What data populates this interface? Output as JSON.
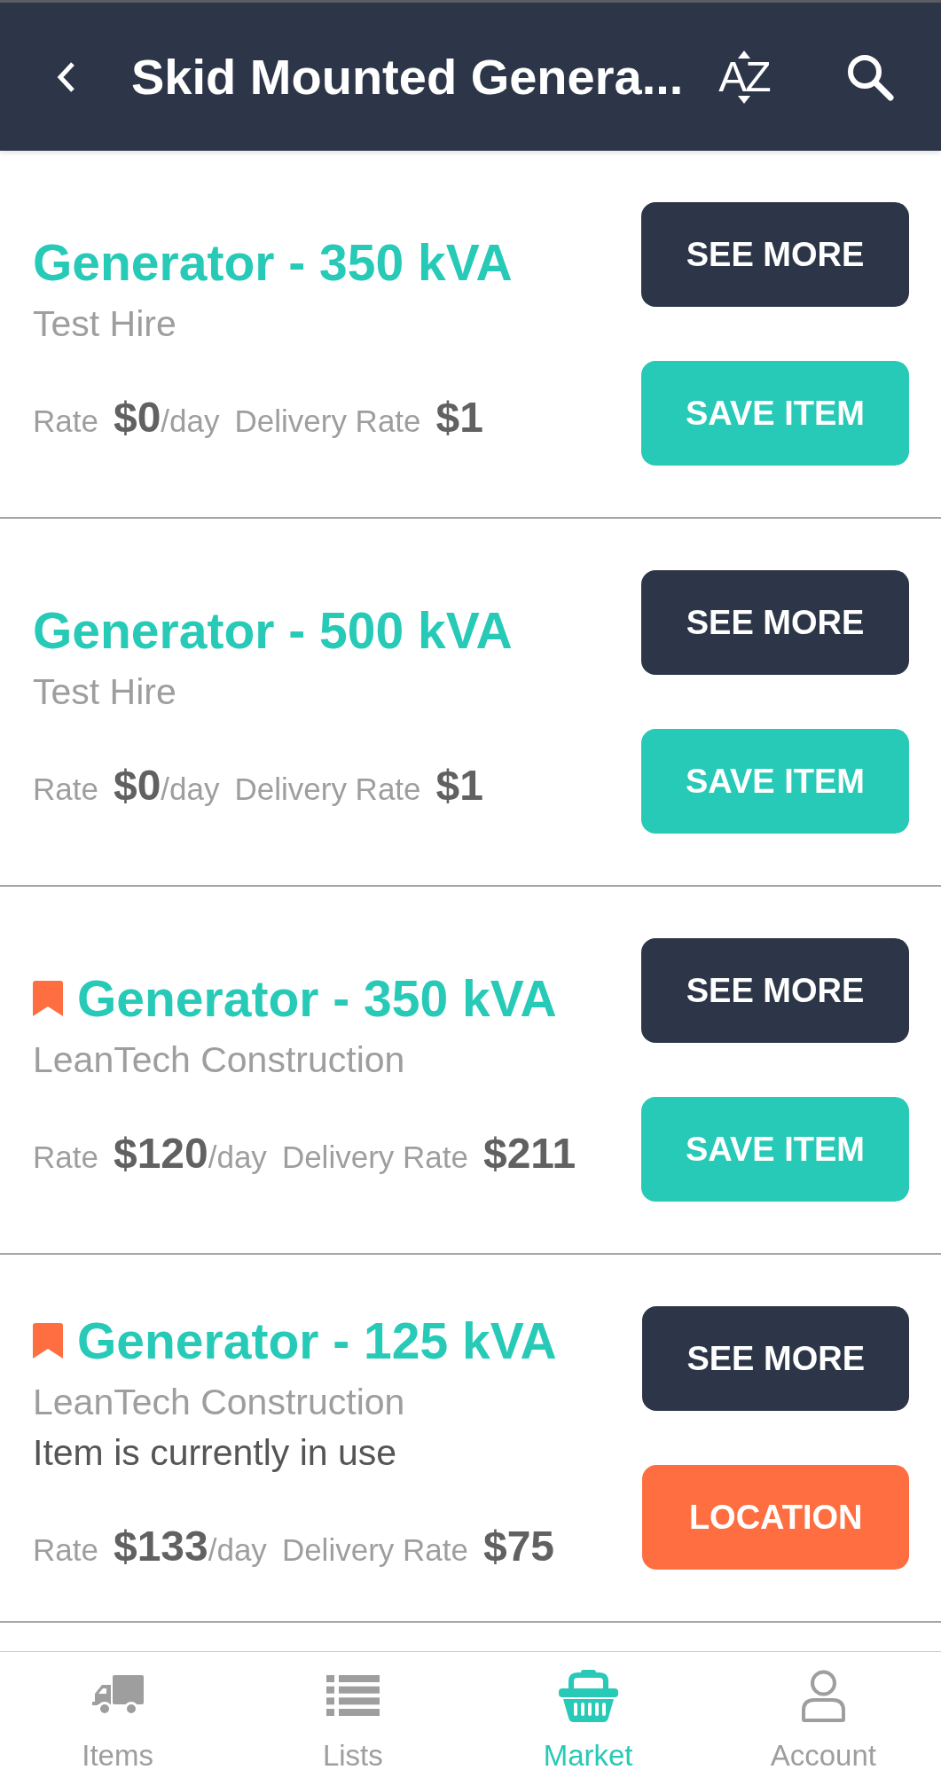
{
  "header": {
    "title": "Skid Mounted Genera...",
    "sort_label": "AZ"
  },
  "cards": [
    {
      "title": "Generator - 350 kVA",
      "bookmarked": false,
      "company": "Test Hire",
      "rate_label": "Rate",
      "rate": "$0",
      "rate_unit": "/day",
      "delivery_label": "Delivery Rate",
      "delivery_rate": "$1",
      "buttons": [
        {
          "label": "SEE MORE",
          "kind": "details"
        },
        {
          "label": "SAVE ITEM",
          "kind": "save"
        }
      ]
    },
    {
      "title": "Generator - 500 kVA",
      "bookmarked": false,
      "company": "Test Hire",
      "rate_label": "Rate",
      "rate": "$0",
      "rate_unit": "/day",
      "delivery_label": "Delivery Rate",
      "delivery_rate": "$1",
      "buttons": [
        {
          "label": "SEE MORE",
          "kind": "details"
        },
        {
          "label": "SAVE ITEM",
          "kind": "save"
        }
      ]
    },
    {
      "title": "Generator - 350 kVA",
      "bookmarked": true,
      "company": "LeanTech Construction",
      "rate_label": "Rate",
      "rate": "$120",
      "rate_unit": "/day",
      "delivery_label": "Delivery Rate",
      "delivery_rate": "$211",
      "buttons": [
        {
          "label": "SEE MORE",
          "kind": "details"
        },
        {
          "label": "SAVE ITEM",
          "kind": "save"
        }
      ]
    },
    {
      "title": "Generator - 125 kVA",
      "bookmarked": true,
      "company": "LeanTech Construction",
      "status": "Item is currently in use",
      "rate_label": "Rate",
      "rate": "$133",
      "rate_unit": "/day",
      "delivery_label": "Delivery Rate",
      "delivery_rate": "$75",
      "buttons": [
        {
          "label": "SEE MORE",
          "kind": "details"
        },
        {
          "label": "LOCATION",
          "kind": "location"
        }
      ]
    }
  ],
  "tabs": [
    {
      "label": "Items",
      "selected": false
    },
    {
      "label": "Lists",
      "selected": false
    },
    {
      "label": "Market",
      "selected": true
    },
    {
      "label": "Account",
      "selected": false
    }
  ]
}
